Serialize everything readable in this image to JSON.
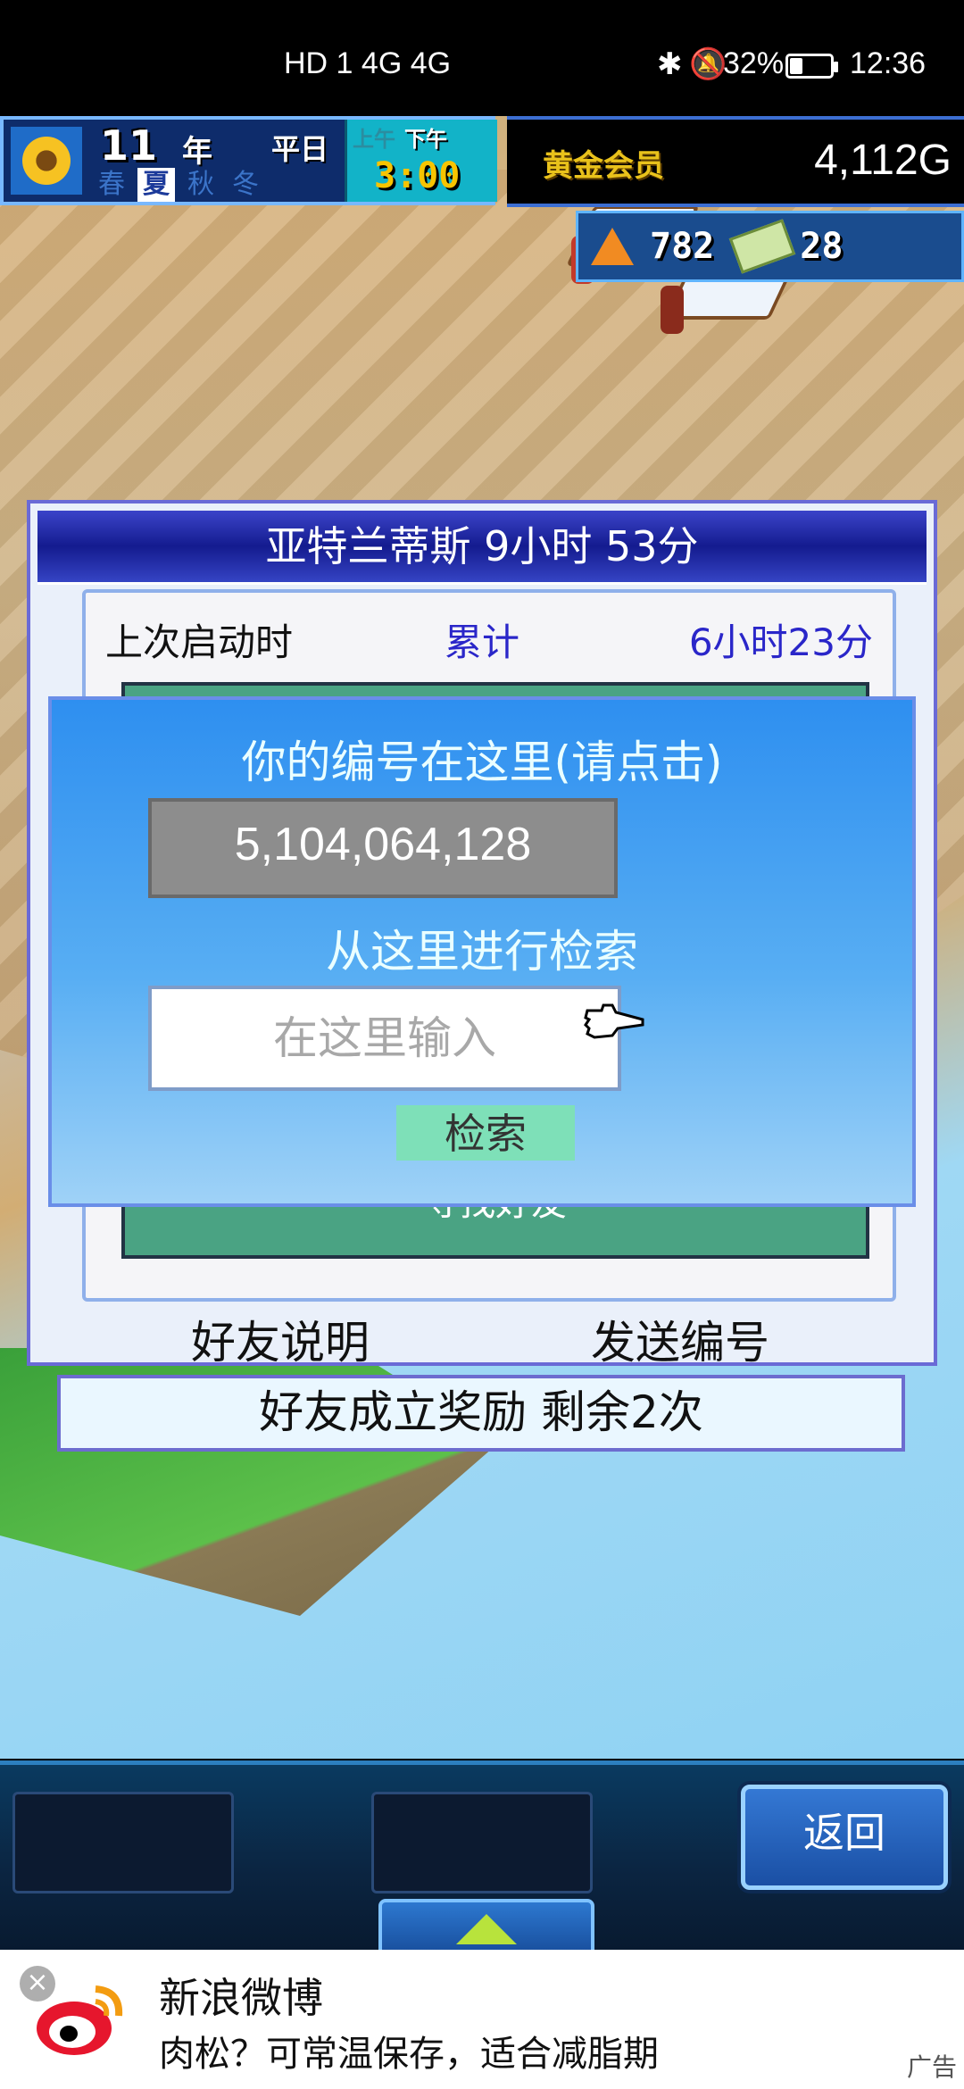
{
  "status_bar": {
    "network": "HD 1  4G  4G",
    "battery": "32%",
    "battery_level": 0.32,
    "time": "12:36"
  },
  "hud": {
    "year": "11",
    "year_unit": "年",
    "weekday": "平日",
    "seasons": [
      "春",
      "夏",
      "秋",
      "冬"
    ],
    "active_season": "夏",
    "am_label": "上午",
    "pm_label": "下午",
    "time": "3:00",
    "member_label": "黄金会员",
    "money": "4,112G",
    "research_points": "782",
    "tickets": "28"
  },
  "panel": {
    "title": "亚特兰蒂斯  9小时 53分",
    "last_launch_label": "上次启动时",
    "total_label": "累计",
    "total_value": "6小时23分",
    "find_friend_label": "寻找好友",
    "friend_help": "好友说明",
    "send_id": "发送编号"
  },
  "dialog": {
    "id_heading": "你的编号在这里(请点击)",
    "id_value": "5,104,064,128",
    "search_heading": "从这里进行检索",
    "search_placeholder": "在这里输入",
    "search_button": "检索"
  },
  "reward_bar": "好友成立奖励  剩余2次",
  "toolbar": {
    "back_label": "返回"
  },
  "ad": {
    "close": "×",
    "title": "新浪微博",
    "description": "肉松？可常温保存，适合减脂期",
    "label": "广告"
  },
  "colors": {
    "dialog_top": "#2e8ff0",
    "dialog_bottom": "#9fd2f7",
    "title_bar": "#141b8f",
    "search_button": "#7ee0b8",
    "money_text": "#ffffff"
  }
}
